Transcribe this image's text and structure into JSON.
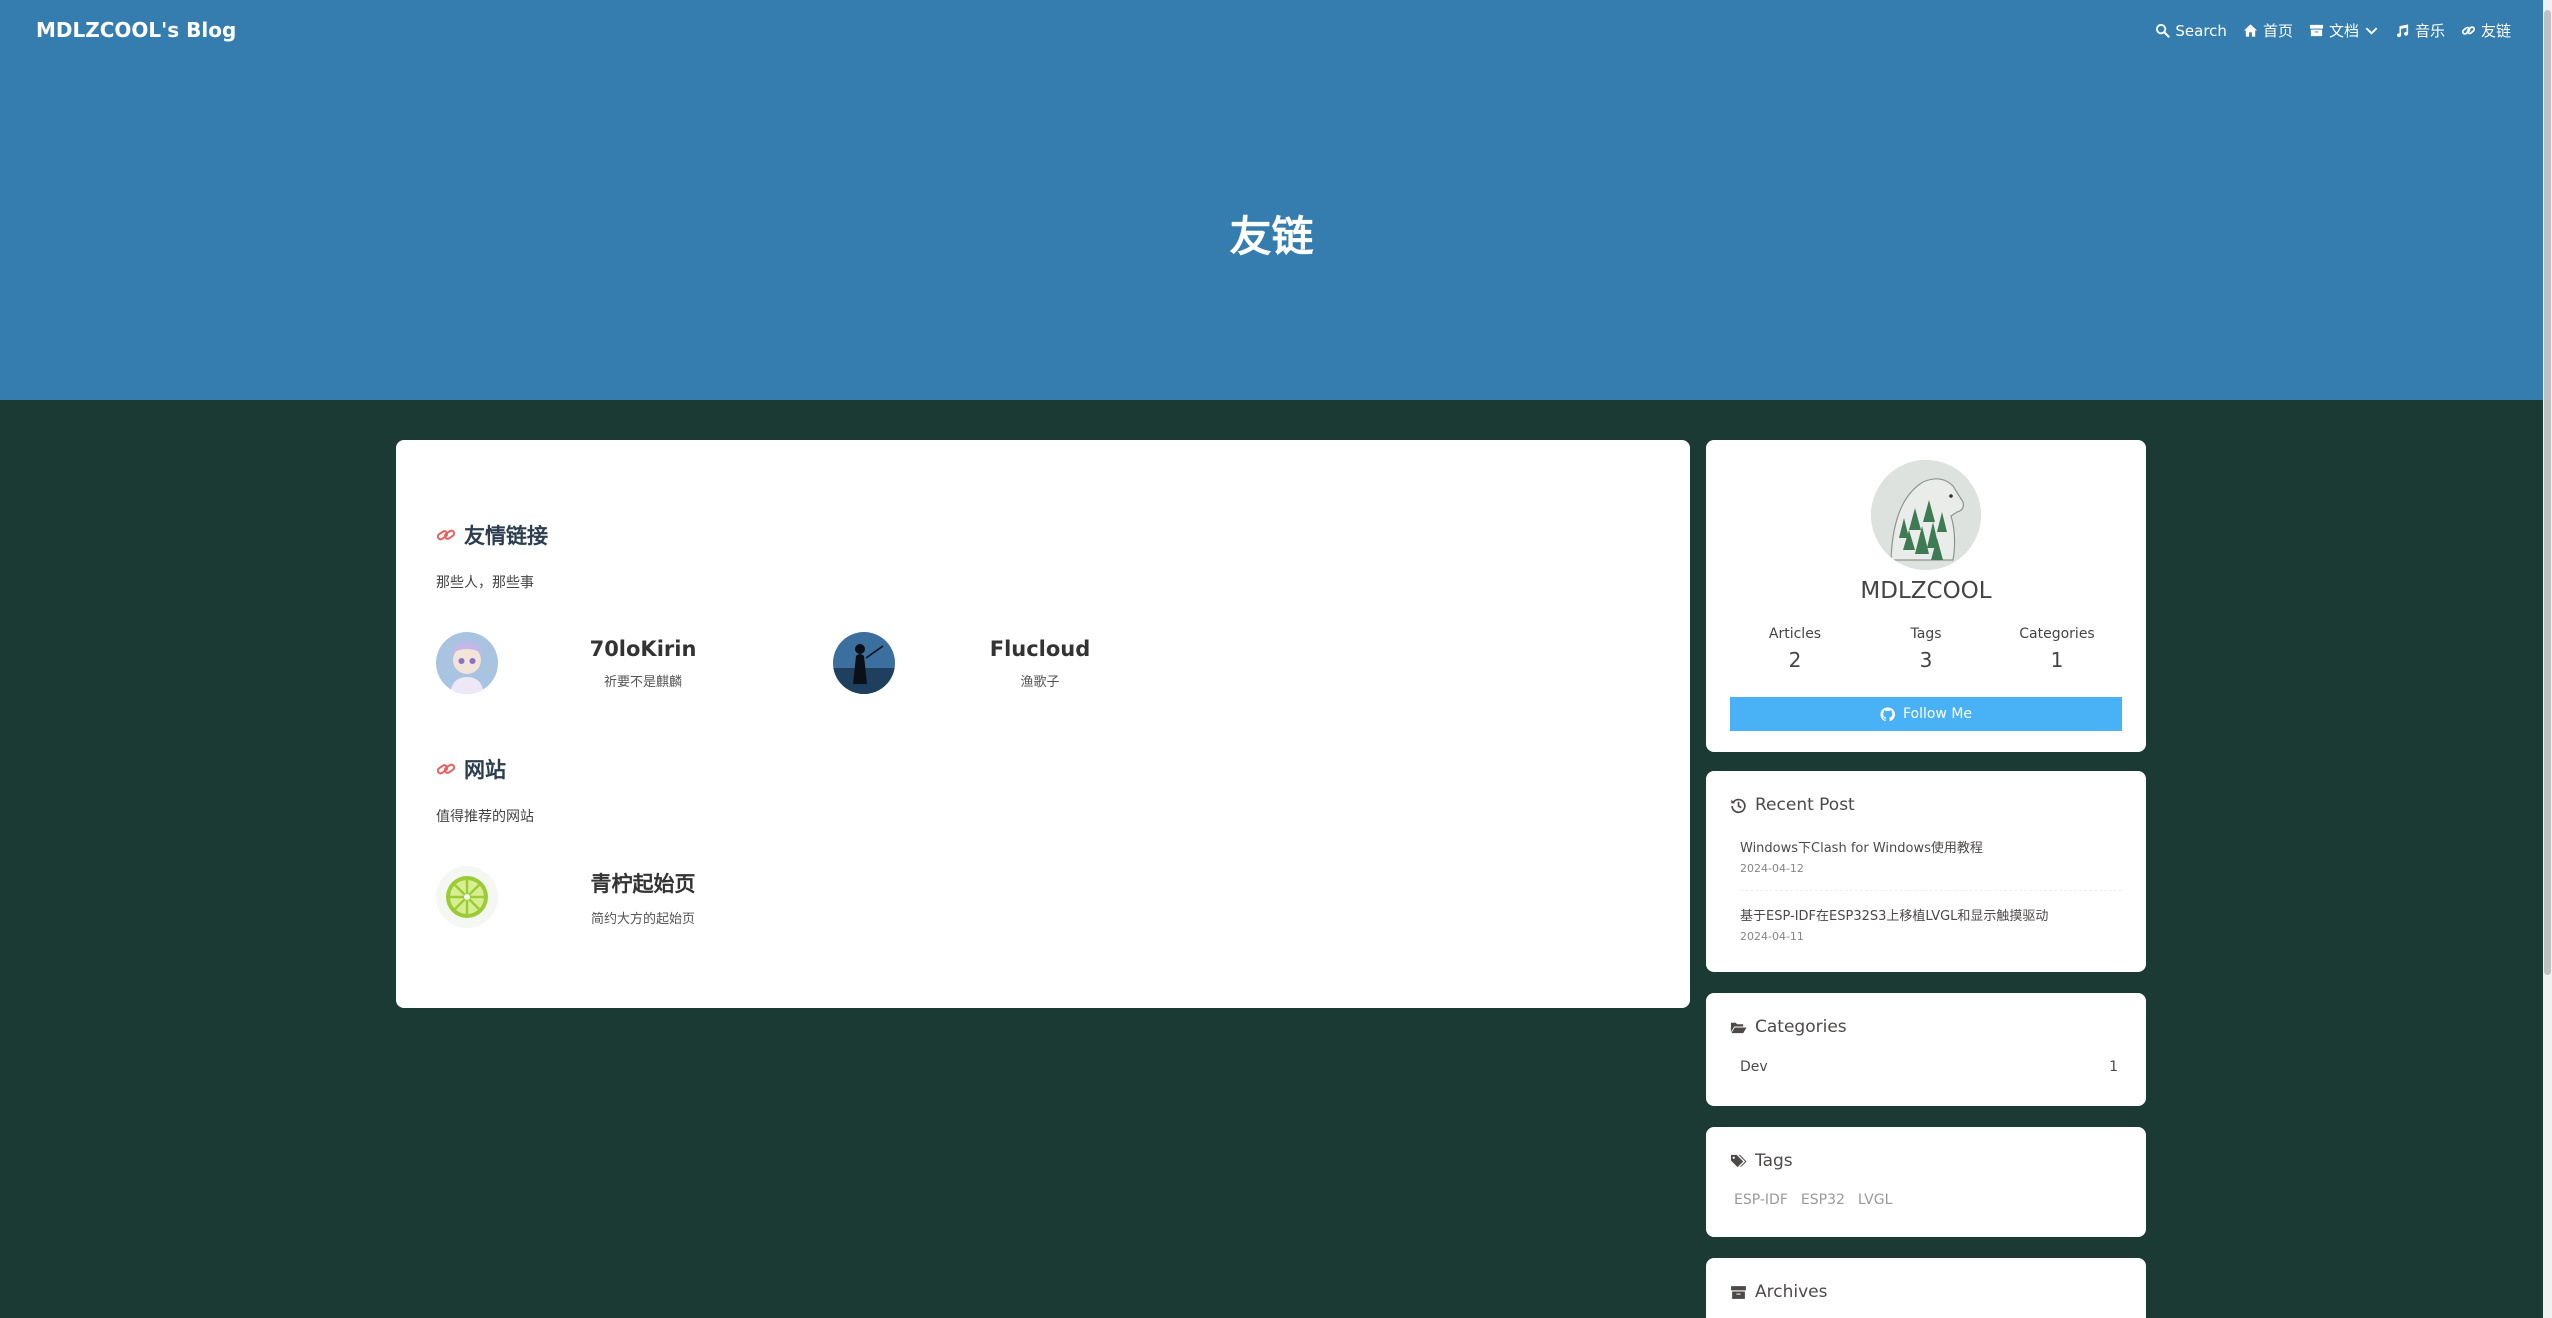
{
  "site": {
    "brand": "MDLZCOOL's Blog",
    "page_title": "友链"
  },
  "nav": {
    "items": [
      {
        "label": "Search",
        "icon": "search-icon"
      },
      {
        "label": "首页",
        "icon": "home-icon"
      },
      {
        "label": "文档",
        "icon": "archive-icon",
        "dropdown": true
      },
      {
        "label": "音乐",
        "icon": "music-icon"
      },
      {
        "label": "友链",
        "icon": "link-icon"
      }
    ]
  },
  "friends": {
    "title": "友情链接",
    "desc": "那些人，那些事",
    "links": [
      {
        "name": "70loKirin",
        "desc": "祈要不是麒麟"
      },
      {
        "name": "Flucloud",
        "desc": "渔歌子"
      }
    ]
  },
  "websites": {
    "title": "网站",
    "desc": "值得推荐的网站",
    "links": [
      {
        "name": "青柠起始页",
        "desc": "简约大方的起始页"
      }
    ]
  },
  "author": {
    "name": "MDLZCOOL",
    "stats": [
      {
        "label": "Articles",
        "value": "2"
      },
      {
        "label": "Tags",
        "value": "3"
      },
      {
        "label": "Categories",
        "value": "1"
      }
    ],
    "follow_label": "Follow Me"
  },
  "recent_posts": {
    "title": "Recent Post",
    "items": [
      {
        "title": "Windows下Clash for Windows使用教程",
        "date": "2024-04-12"
      },
      {
        "title": "基于ESP-IDF在ESP32S3上移植LVGL和显示触摸驱动",
        "date": "2024-04-11"
      }
    ]
  },
  "categories": {
    "title": "Categories",
    "items": [
      {
        "name": "Dev",
        "count": "1"
      }
    ]
  },
  "tags": {
    "title": "Tags",
    "items": [
      "ESP-IDF",
      "ESP32",
      "LVGL"
    ]
  },
  "archives": {
    "title": "Archives"
  },
  "colors": {
    "banner": "#357dae",
    "background": "#1a3a33",
    "accent": "#49b1f5",
    "link_icon": "#e9615e"
  }
}
